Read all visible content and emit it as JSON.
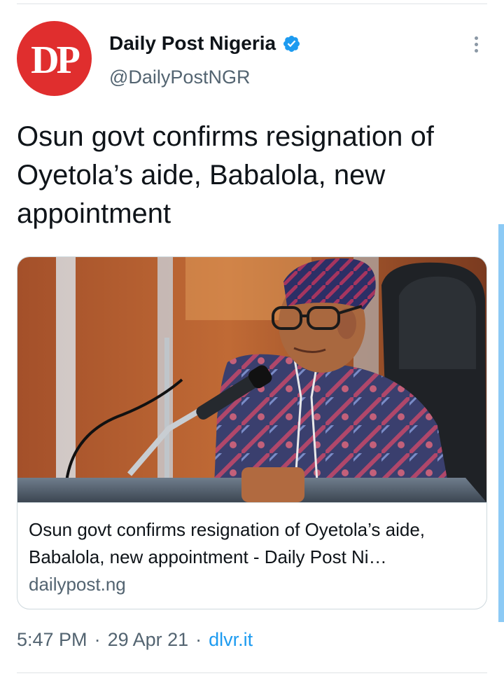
{
  "account": {
    "name": "Daily Post Nigeria",
    "handle": "@DailyPostNGR",
    "avatar_text": "DP",
    "verified": true
  },
  "tweet": {
    "text": "Osun govt confirms resignation of Oyetola’s aide, Babalola, new appointment"
  },
  "card": {
    "title": "Osun govt confirms resignation of Oyetola’s aide, Babalola, new appointment - Daily Post Ni…",
    "domain": "dailypost.ng"
  },
  "meta": {
    "time": "5:47 PM",
    "separator": "·",
    "date": "29 Apr 21",
    "source": "dlvr.it"
  },
  "icons": {
    "verified": "verified-badge-icon",
    "more": "more-options-icon"
  },
  "colors": {
    "brand_red": "#e02e2e",
    "link_blue": "#1d9bf0",
    "secondary_text": "#536471"
  }
}
